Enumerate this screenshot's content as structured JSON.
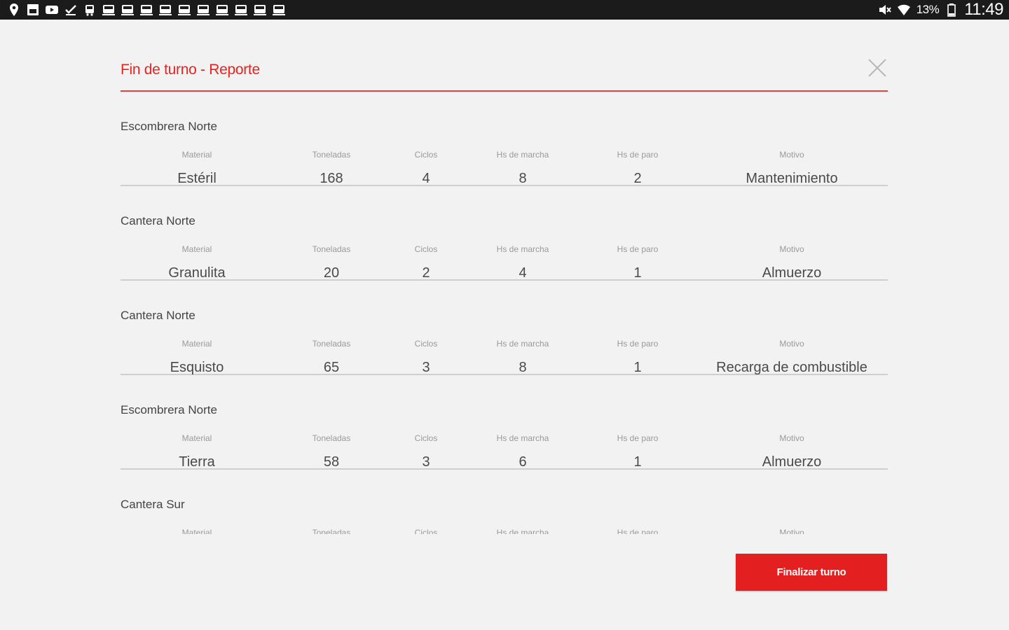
{
  "statusbar": {
    "left_icons": [
      "location-icon",
      "sim-icon",
      "youtube-icon",
      "checkmark-icon",
      "bus-icon",
      "train-icon",
      "train-icon",
      "train-icon",
      "train-icon",
      "train-icon",
      "train-icon",
      "train-icon",
      "train-icon",
      "train-icon",
      "train-icon"
    ],
    "battery_percent": "13%",
    "time": "11:49"
  },
  "dialog": {
    "title": "Fin de turno - Reporte",
    "accent_color": "#e8231f"
  },
  "columns": {
    "material": "Material",
    "toneladas": "Toneladas",
    "ciclos": "Ciclos",
    "hs_marcha": "Hs de marcha",
    "hs_paro": "Hs de paro",
    "motivo": "Motivo"
  },
  "groups": [
    {
      "name": "Escombrera Norte",
      "material": "Estéril",
      "toneladas": "168",
      "ciclos": "4",
      "hs_marcha": "8",
      "hs_paro": "2",
      "motivo": "Mantenimiento"
    },
    {
      "name": "Cantera Norte",
      "material": "Granulita",
      "toneladas": "20",
      "ciclos": "2",
      "hs_marcha": "4",
      "hs_paro": "1",
      "motivo": "Almuerzo"
    },
    {
      "name": "Cantera Norte",
      "material": "Esquisto",
      "toneladas": "65",
      "ciclos": "3",
      "hs_marcha": "8",
      "hs_paro": "1",
      "motivo": "Recarga de combustible"
    },
    {
      "name": "Escombrera Norte",
      "material": "Tierra",
      "toneladas": "58",
      "ciclos": "3",
      "hs_marcha": "6",
      "hs_paro": "1",
      "motivo": "Almuerzo"
    },
    {
      "name": "Cantera Sur",
      "material": "",
      "toneladas": "",
      "ciclos": "",
      "hs_marcha": "",
      "hs_paro": "",
      "motivo": ""
    }
  ],
  "footer": {
    "finish_label": "Finalizar turno"
  }
}
